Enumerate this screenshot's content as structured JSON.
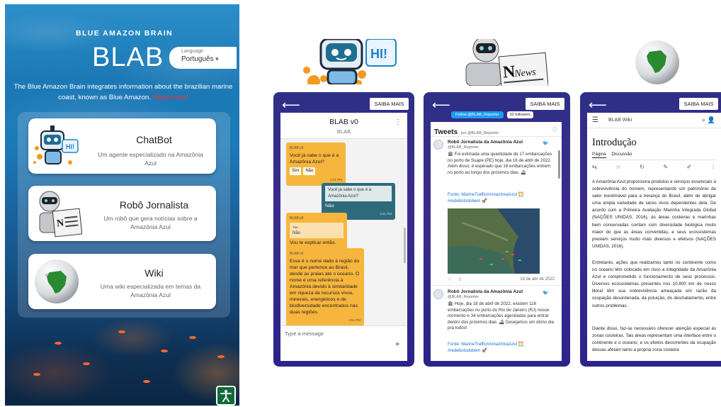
{
  "left_panel": {
    "brand": "BLUE AMAZON BRAIN",
    "logo": "BLAB",
    "language": {
      "caption": "Language",
      "selected": "Português"
    },
    "intro": "The Blue Amazon Brain integrates information about the brazilian marine coast, known as Blue Amazon.",
    "read_more": "Read more!",
    "cards": [
      {
        "title": "ChatBot",
        "desc": "Um agente especializado na Amazônia Azul",
        "icon": "robot-hi-icon"
      },
      {
        "title": "Robô Jornalista",
        "desc": "Um robô que gera notícias sobre a Amazônia Azul",
        "icon": "robot-news-icon"
      },
      {
        "title": "Wiki",
        "desc": "Uma wiki especializada em temas da Amazônia Azul",
        "icon": "globe-brazil-icon"
      }
    ],
    "accessibility_icon": "accessibility-icon"
  },
  "top_icons": {
    "hi_badge": "HI!",
    "news_label": "News"
  },
  "chat_phone": {
    "back_icon": "arrow-left-icon",
    "saiba_mais": "SAIBA MAIS",
    "header": {
      "title": "BLAB v0",
      "subtitle": "BLAB",
      "menu": "⋮"
    },
    "messages": [
      {
        "who": "BLAB v0",
        "text": "Você já sabe o que é a Amazônia Azul?",
        "time": "4:51 PM",
        "options": [
          "Sim",
          "Não"
        ]
      },
      {
        "who": "",
        "quote": "Você já sabe o que é a Amazônia Azul?",
        "text": "Não",
        "time": "4:51 PM"
      },
      {
        "who": "BLAB v0",
        "quote_title": "You",
        "quote": "Não",
        "text": "Vou te explicar então.",
        "time": "4:51 PM"
      },
      {
        "who": "BLAB v0",
        "text": "Esse é o nome dado à região do mar que pertence ao Brasil, desde as praias até o oceano. O nome é uma referência à Amazônia devido à similaridade em riqueza de recursos vivos, minerais, energéticos e de biodiversidade encontrados nas duas regiões.",
        "time": "4:51 PM"
      }
    ],
    "input_placeholder": "Type a message",
    "send_icon": "send-icon"
  },
  "twitter_phone": {
    "back_icon": "arrow-left-icon",
    "saiba_mais": "SAIBA MAIS",
    "follow_button": "Follow @BLAB_Reporter",
    "followers": "32 followers",
    "header_title": "Tweets",
    "header_by": "por @BLAB_Reporter",
    "info_icon": "info-icon",
    "tweets": [
      {
        "name": "Robô Jornalista da Amazônia Azul",
        "handle": "@BLAB_Reporter",
        "text": "🏛 Foi estimada uma quantidade de 17 embarcações no porto de Suape (PE) hoje, dia 18 de abril de 2022. Além disso, é esperado que 18 embarcações entrem no porto ao longo dos próximos dias. 🚢",
        "source": "Fonte: MarineTraffic#AmazôniaAzul 🌅 #redebotsdobem 🚀",
        "date": "18 de abr de 2022"
      },
      {
        "name": "Robô Jornalista da Amazônia Azul",
        "handle": "@BLAB_Reporter",
        "text": "🏛 Hoje, dia 18 de abril de 2022, existem 116 embarcações no porto do Rio de Janeiro (RJ) nesse momento e 34 embarcações agendadas para entrar dentro dos próximos dias. 🚢 Desejamos um ótimo dia pra todos!",
        "source": "Fonte: MarineTraffic#AmazôniaAzul 🌅 #redebotsdobem 🚀"
      }
    ]
  },
  "wiki_phone": {
    "back_icon": "arrow-left-icon",
    "saiba_mais": "SAIBA MAIS",
    "bar_title": "BLAB Wiki",
    "heading": "Introdução",
    "tabs": [
      "Página",
      "Discussão"
    ],
    "paragraphs": [
      "A Amazônia Azul proporciona produtos e serviços essenciais à sobrevivência do homem, representando um patrimônio de valor inestimável para a herança do Brasil, além de abrigar uma ampla variedade de seres vivos dependentes dela. De acordo com a Primeira Avaliação Marinha Integrada Global (NAÇÕES UNIDAS, 2016), as áreas costeiras e marinhas bem conservadas contam com diversidade biológica muito maior do que as áreas convertidas, e seus ecossistemas prestam serviços muito mais diversos e efetivos (NAÇÕES UNIDAS, 2016).",
      "Entretanto, ações que realizamos tanto no continente como no oceano têm colocado em risco a integridade da Amazônia Azul e comprometido o funcionamento de seus processos. Diversos ecossistemas presentes nos 10.800 km de nosso litoral têm sua sobrevivência ameaçada em razão da ocupação desordenada, da poluição, do desmatamento, entre outros problemas.",
      "Diante disso, faz-se necessário oferecer atenção especial às zonas costeiras. Tais áreas representam uma interface entre o continente e o oceano, e os efeitos decorrentes da ocupação dessas afetam tanto a própria zona costeira"
    ]
  }
}
